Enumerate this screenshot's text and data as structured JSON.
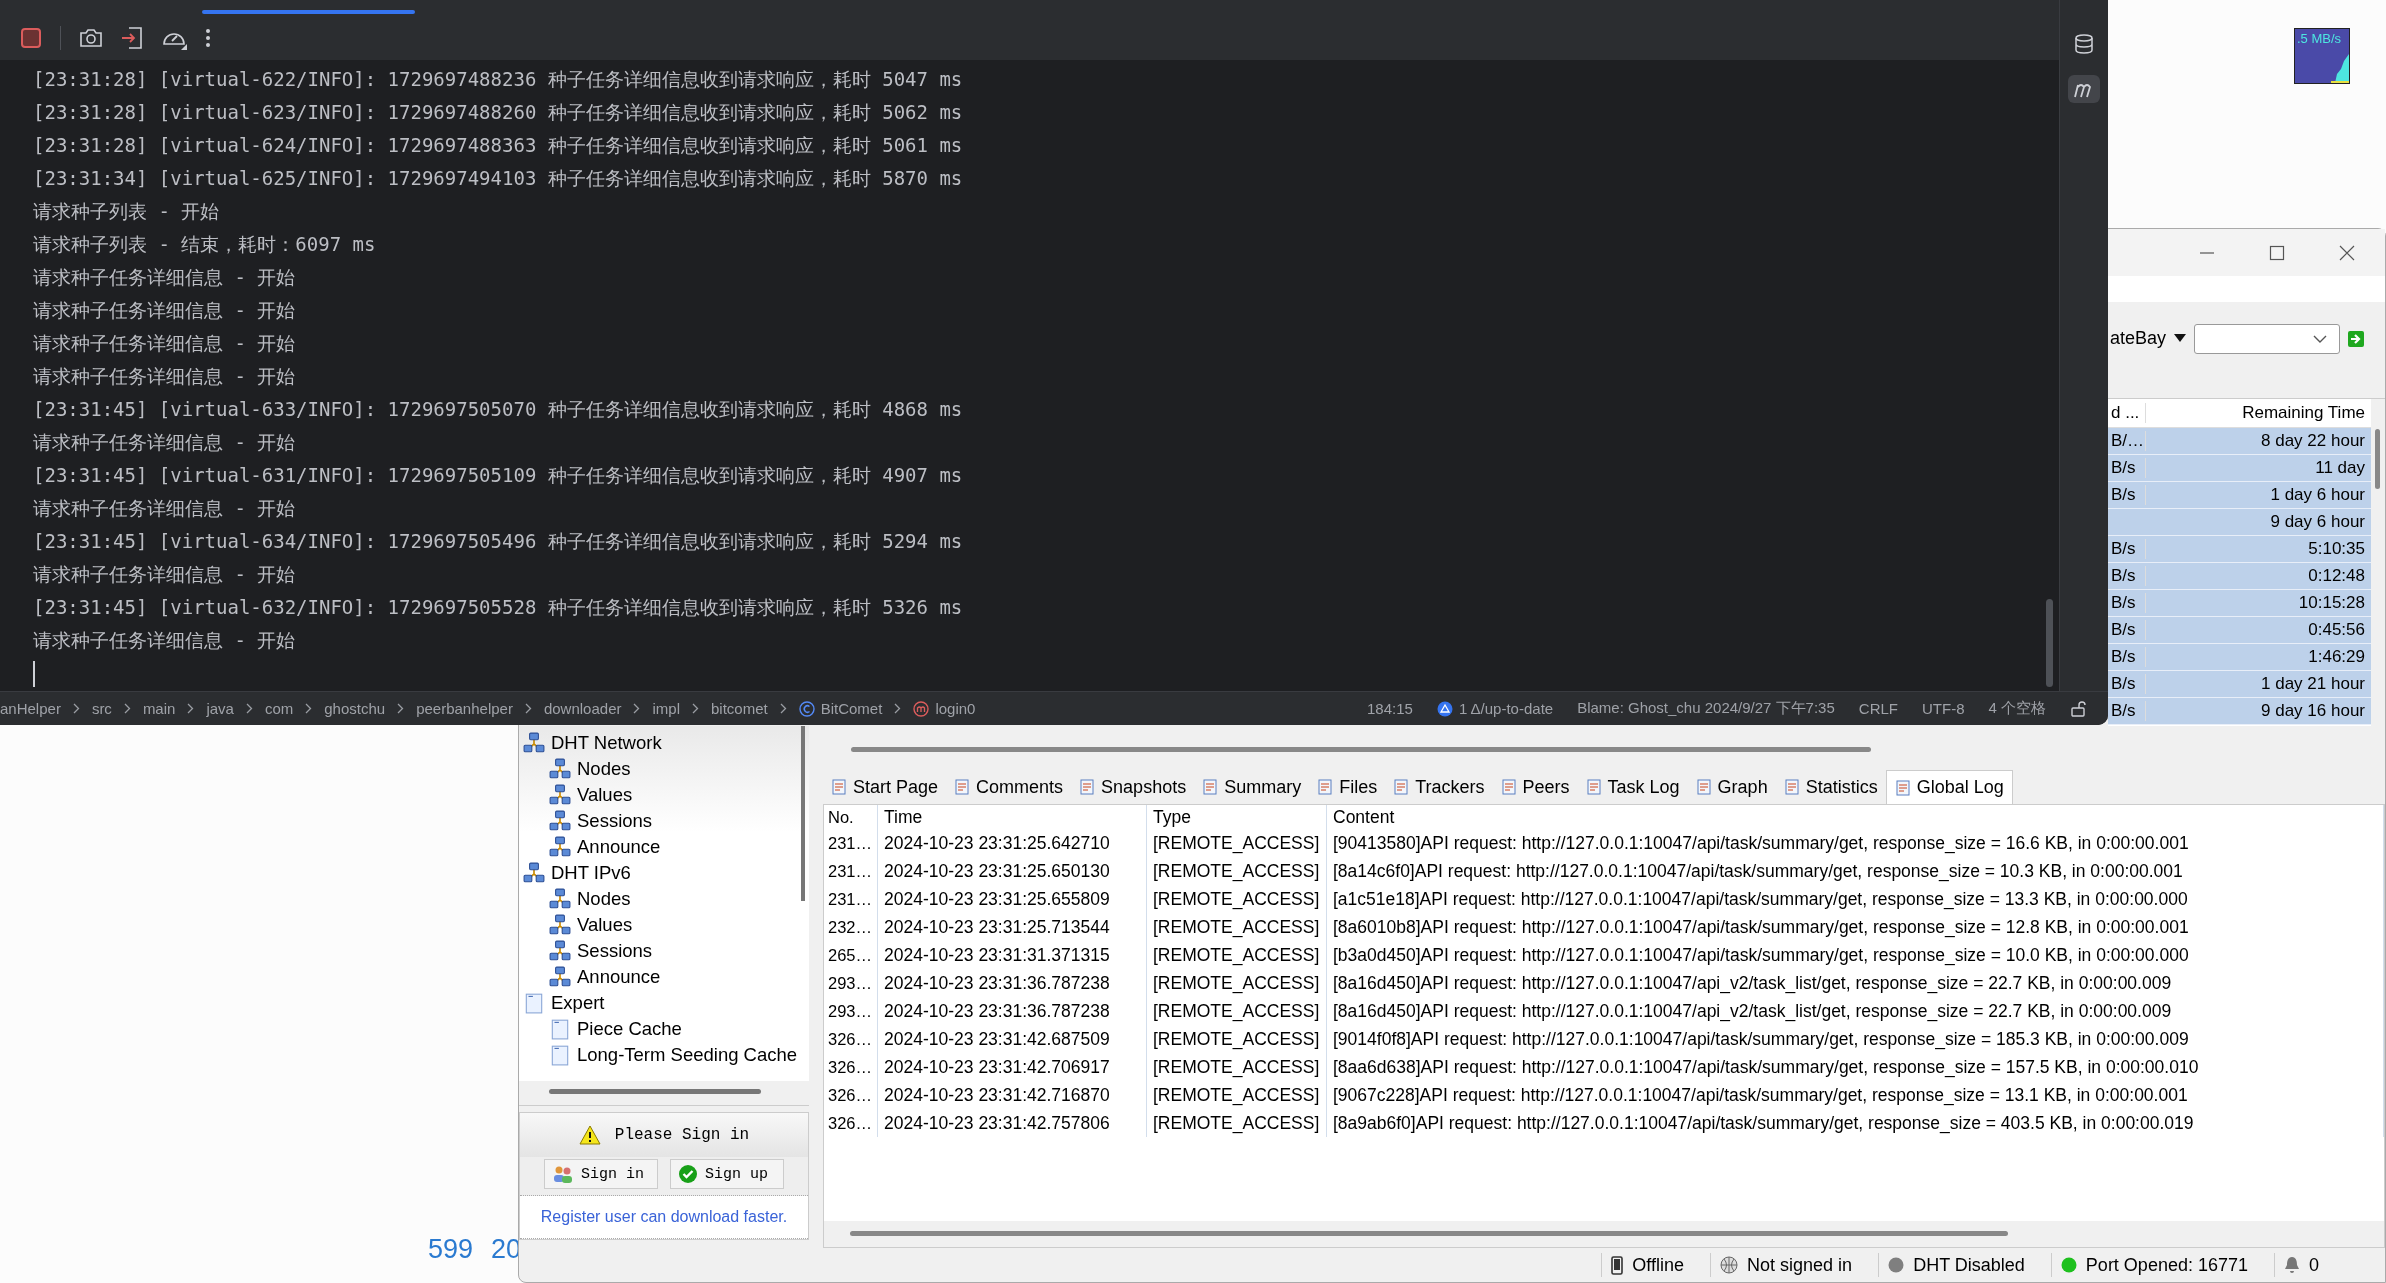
{
  "ide": {
    "terminal": {
      "lines": [
        "[23:31:28] [virtual-622/INFO]: 1729697488236 种子任务详细信息收到请求响应，耗时 5047 ms",
        "[23:31:28] [virtual-623/INFO]: 1729697488260 种子任务详细信息收到请求响应，耗时 5062 ms",
        "[23:31:28] [virtual-624/INFO]: 1729697488363 种子任务详细信息收到请求响应，耗时 5061 ms",
        "[23:31:34] [virtual-625/INFO]: 1729697494103 种子任务详细信息收到请求响应，耗时 5870 ms",
        "请求种子列表 - 开始",
        "请求种子列表 - 结束，耗时：6097 ms",
        "请求种子任务详细信息 - 开始",
        "请求种子任务详细信息 - 开始",
        "请求种子任务详细信息 - 开始",
        "请求种子任务详细信息 - 开始",
        "[23:31:45] [virtual-633/INFO]: 1729697505070 种子任务详细信息收到请求响应，耗时 4868 ms",
        "请求种子任务详细信息 - 开始",
        "[23:31:45] [virtual-631/INFO]: 1729697505109 种子任务详细信息收到请求响应，耗时 4907 ms",
        "请求种子任务详细信息 - 开始",
        "[23:31:45] [virtual-634/INFO]: 1729697505496 种子任务详细信息收到请求响应，耗时 5294 ms",
        "请求种子任务详细信息 - 开始",
        "[23:31:45] [virtual-632/INFO]: 1729697505528 种子任务详细信息收到请求响应，耗时 5326 ms",
        "请求种子任务详细信息 - 开始"
      ]
    },
    "breadcrumb": [
      {
        "label": "anHelper"
      },
      {
        "label": "src"
      },
      {
        "label": "main"
      },
      {
        "label": "java"
      },
      {
        "label": "com"
      },
      {
        "label": "ghostchu"
      },
      {
        "label": "peerbanhelper"
      },
      {
        "label": "downloader"
      },
      {
        "label": "impl"
      },
      {
        "label": "bitcomet"
      },
      {
        "label": "BitComet",
        "kind": "class"
      },
      {
        "label": "login0",
        "kind": "method"
      }
    ],
    "status": [
      {
        "label": "184:15"
      },
      {
        "label": "1 Δ/up-to-date",
        "kind": "vcs"
      },
      {
        "label": "Blame: Ghost_chu 2024/9/27 下午7:35"
      },
      {
        "label": "CRLF"
      },
      {
        "label": "UTF-8"
      },
      {
        "label": "4 个空格"
      }
    ]
  },
  "speed_widget": {
    "text": ".5 MB/s"
  },
  "desktop": {
    "texts": [
      "599",
      "20"
    ]
  },
  "bitcomet": {
    "search": {
      "site": "ateBay"
    },
    "task_table": {
      "columns": [
        "d ...",
        "Remaining Time"
      ],
      "rows": [
        {
          "column_1": "B/…",
          "remaining_time": "8 day 22 hour",
          "selected": true
        },
        {
          "column_1": "B/s",
          "remaining_time": "11 day",
          "selected": true
        },
        {
          "column_1": "B/s",
          "remaining_time": "1 day 6 hour",
          "selected": true
        },
        {
          "remaining_time": "9 day 6 hour",
          "selected": true
        },
        {
          "column_1": "B/s",
          "remaining_time": "5:10:35",
          "selected": true
        },
        {
          "column_1": "B/s",
          "remaining_time": "0:12:48",
          "selected": true
        },
        {
          "column_1": "B/s",
          "remaining_time": "10:15:28",
          "selected": true
        },
        {
          "column_1": "B/s",
          "remaining_time": "0:45:56",
          "selected": true
        },
        {
          "column_1": "B/s",
          "remaining_time": "1:46:29",
          "selected": true
        },
        {
          "column_1": "B/s",
          "remaining_time": "1 day 21 hour",
          "selected": true
        },
        {
          "column_1": "B/s",
          "remaining_time": "9 day 16 hour",
          "selected": true
        }
      ]
    },
    "tree": [
      {
        "label": "DHT Network",
        "kind": "network",
        "children": [
          {
            "label": "Nodes",
            "kind": "network"
          },
          {
            "label": "Values",
            "kind": "network"
          },
          {
            "label": "Sessions",
            "kind": "network"
          },
          {
            "label": "Announce",
            "kind": "network"
          }
        ]
      },
      {
        "label": "DHT IPv6",
        "kind": "network",
        "children": [
          {
            "label": "Nodes",
            "kind": "network"
          },
          {
            "label": "Values",
            "kind": "network"
          },
          {
            "label": "Sessions",
            "kind": "network"
          },
          {
            "label": "Announce",
            "kind": "network"
          }
        ]
      },
      {
        "label": "Expert",
        "kind": "page",
        "children": [
          {
            "label": "Piece Cache",
            "kind": "page"
          },
          {
            "label": "Long-Term Seeding Cache",
            "kind": "page"
          }
        ]
      }
    ],
    "sign_in": {
      "title": "Please Sign in",
      "sign_in_button": "Sign in",
      "sign_up_button": "Sign up",
      "link": "Register user can download faster."
    },
    "tabs": [
      {
        "label": "Start Page",
        "selected": false
      },
      {
        "label": "Comments",
        "selected": false
      },
      {
        "label": "Snapshots",
        "selected": false
      },
      {
        "label": "Summary",
        "selected": false
      },
      {
        "label": "Files",
        "selected": false
      },
      {
        "label": "Trackers",
        "selected": false
      },
      {
        "label": "Peers",
        "selected": false
      },
      {
        "label": "Task Log",
        "selected": false
      },
      {
        "label": "Graph",
        "selected": false
      },
      {
        "label": "Statistics",
        "selected": false
      },
      {
        "label": "Global Log",
        "selected": true
      }
    ],
    "log_table": {
      "columns": [
        "No.",
        "Time",
        "Type",
        "Content"
      ],
      "rows": [
        [
          "231…",
          "2024-10-23 23:31:25.642710",
          "[REMOTE_ACCESS]",
          "[90413580]API request: http://127.0.0.1:10047/api/task/summary/get, response_size = 16.6 KB, in 0:00:00.001"
        ],
        [
          "231…",
          "2024-10-23 23:31:25.650130",
          "[REMOTE_ACCESS]",
          "[8a14c6f0]API request: http://127.0.0.1:10047/api/task/summary/get, response_size = 10.3 KB, in 0:00:00.001"
        ],
        [
          "231…",
          "2024-10-23 23:31:25.655809",
          "[REMOTE_ACCESS]",
          "[a1c51e18]API request: http://127.0.0.1:10047/api/task/summary/get, response_size = 13.3 KB, in 0:00:00.000"
        ],
        [
          "232…",
          "2024-10-23 23:31:25.713544",
          "[REMOTE_ACCESS]",
          "[8a6010b8]API request: http://127.0.0.1:10047/api/task/summary/get, response_size = 12.8 KB, in 0:00:00.001"
        ],
        [
          "265…",
          "2024-10-23 23:31:31.371315",
          "[REMOTE_ACCESS]",
          "[b3a0d450]API request: http://127.0.0.1:10047/api/task/summary/get, response_size = 10.0 KB, in 0:00:00.000"
        ],
        [
          "293…",
          "2024-10-23 23:31:36.787238",
          "[REMOTE_ACCESS]",
          "[8a16d450]API request: http://127.0.0.1:10047/api_v2/task_list/get, response_size = 22.7 KB, in 0:00:00.009"
        ],
        [
          "293…",
          "2024-10-23 23:31:36.787238",
          "[REMOTE_ACCESS]",
          "[8a16d450]API request: http://127.0.0.1:10047/api_v2/task_list/get, response_size = 22.7 KB, in 0:00:00.009"
        ],
        [
          "326…",
          "2024-10-23 23:31:42.687509",
          "[REMOTE_ACCESS]",
          "[9014f0f8]API request: http://127.0.0.1:10047/api/task/summary/get, response_size = 185.3 KB, in 0:00:00.009"
        ],
        [
          "326…",
          "2024-10-23 23:31:42.706917",
          "[REMOTE_ACCESS]",
          "[8aa6d638]API request: http://127.0.0.1:10047/api/task/summary/get, response_size = 157.5 KB, in 0:00:00.010"
        ],
        [
          "326…",
          "2024-10-23 23:31:42.716870",
          "[REMOTE_ACCESS]",
          "[9067c228]API request: http://127.0.0.1:10047/api/task/summary/get, response_size = 13.1 KB, in 0:00:00.001"
        ],
        [
          "326…",
          "2024-10-23 23:31:42.757806",
          "[REMOTE_ACCESS]",
          "[8a9ab6f0]API request: http://127.0.0.1:10047/api/task/summary/get, response_size = 403.5 KB, in 0:00:00.019"
        ]
      ]
    },
    "status_bar": [
      {
        "label": "Offline",
        "kind": "phone"
      },
      {
        "label": "Not signed in",
        "kind": "globe"
      },
      {
        "label": "DHT Disabled",
        "kind": "dot",
        "color": "#7f7f7f"
      },
      {
        "label": "Port Opened: 16771",
        "kind": "dot",
        "color": "#1ec01e"
      },
      {
        "label": "0",
        "kind": "bell"
      }
    ]
  }
}
